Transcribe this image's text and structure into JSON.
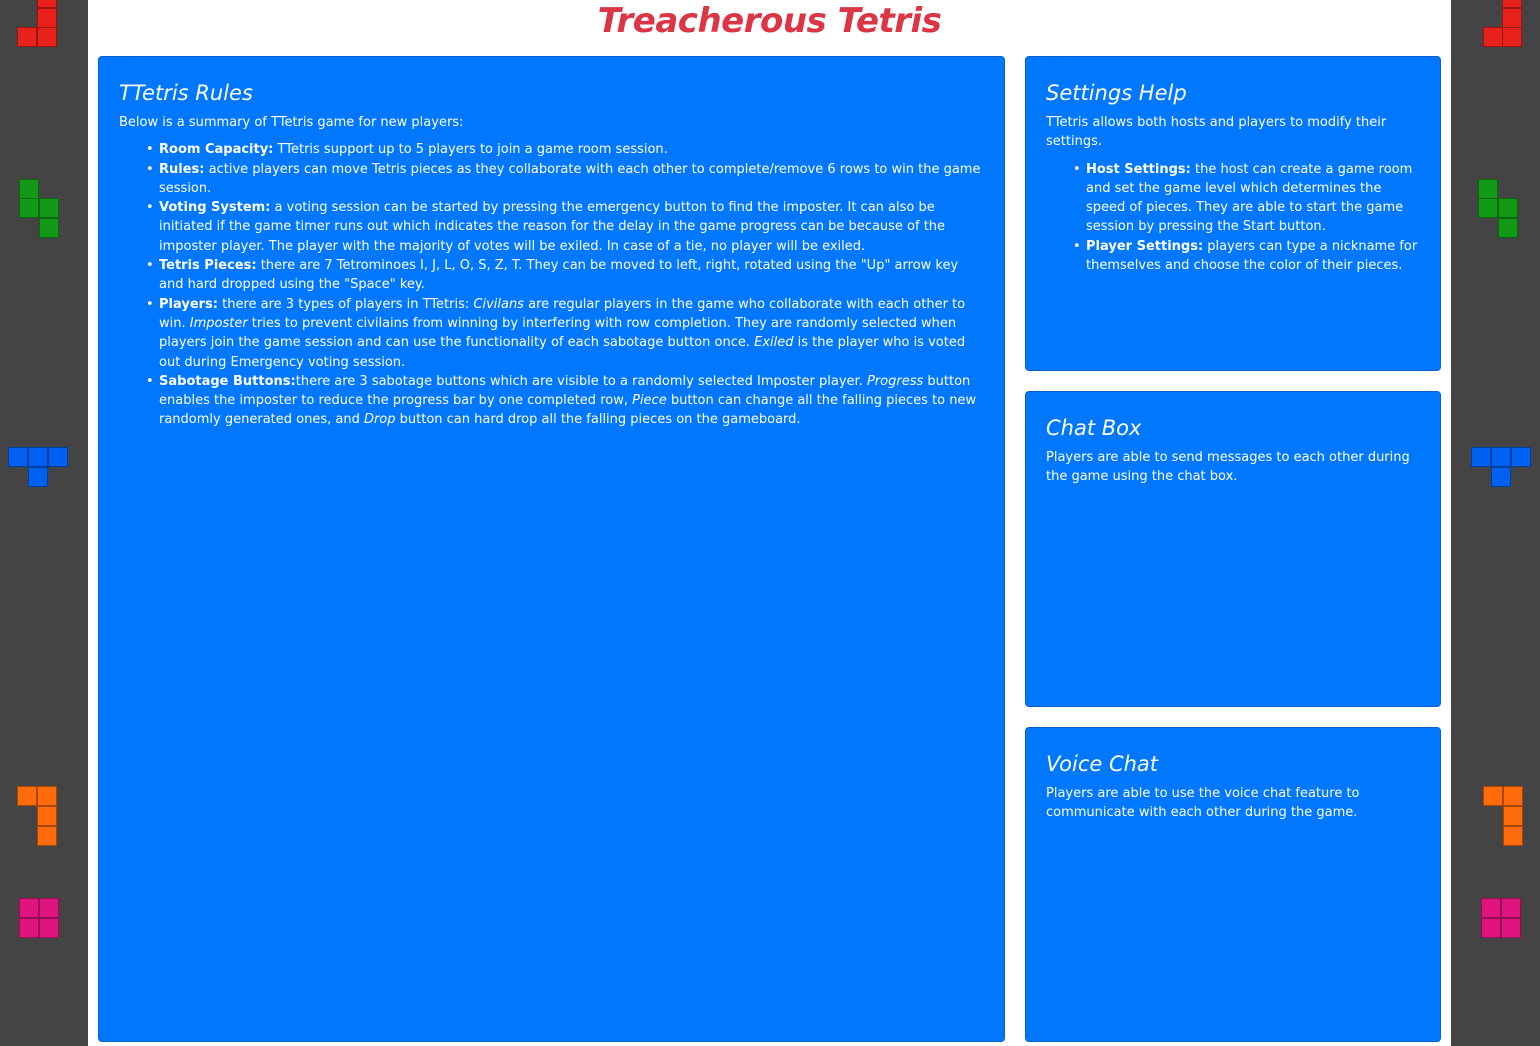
{
  "page": {
    "title": "Treacherous Tetris"
  },
  "colors": {
    "side": "#444444",
    "card": "#0077ff",
    "title": "#dc3545",
    "red": "#e8221b",
    "green": "#129a17",
    "blue": "#0060f0",
    "orange": "#ff6a0a",
    "pink": "#e0147e"
  },
  "rules": {
    "heading": "TTetris Rules",
    "intro": "Below is a summary of TTetris game for new players:",
    "items": [
      {
        "label": "Room Capacity:",
        "text": " TTetris support up to 5 players to join a game room session."
      },
      {
        "label": "Rules:",
        "text": " active players can move Tetris pieces as they collaborate with each other to complete/remove 6 rows to win the game session."
      },
      {
        "label": "Voting System:",
        "text": " a voting session can be started by pressing the emergency button to find the imposter. It can also be initiated if the game timer runs out which indicates the reason for the delay in the game progress can be because of the imposter player. The player with the majority of votes will be exiled. In case of a tie, no player will be exiled."
      },
      {
        "label": "Tetris Pieces:",
        "text": " there are 7 Tetrominoes I, J, L, O, S, Z, T. They can be moved to left, right, rotated using the \"Up\" arrow key and hard dropped using the \"Space\" key."
      },
      {
        "label": "Players:",
        "t1": " there are 3 types of players in TTetris: ",
        "civ": "Civilans",
        "t2": " are regular players in the game who collaborate with each other to win. ",
        "imp": "Imposter",
        "t3": " tries to prevent civilains from winning by interfering with row completion. They are randomly selected when players join the game session and can use the functionality of each sabotage button once. ",
        "exi": "Exiled",
        "t4": " is the player who is voted out during Emergency voting session."
      },
      {
        "label": "Sabotage Buttons:",
        "t1": "there are 3 sabotage buttons which are visible to a randomly selected Imposter player. ",
        "prog": "Progress",
        "t2": " button enables the imposter to reduce the progress bar by one completed row, ",
        "piece": "Piece",
        "t3": " button can change all the falling pieces to new randomly generated ones, and ",
        "drop": "Drop",
        "t4": " button can hard drop all the falling pieces on the gameboard."
      }
    ]
  },
  "settings": {
    "heading": "Settings Help",
    "intro": "TTetris allows both hosts and players to modify their settings.",
    "items": [
      {
        "label": "Host Settings:",
        "text": " the host can create a game room and set the game level which determines the speed of pieces. They are able to start the game session by pressing the Start button."
      },
      {
        "label": "Player Settings:",
        "text": " players can type a nickname for themselves and choose the color of their pieces."
      }
    ]
  },
  "chat": {
    "heading": "Chat Box",
    "text": "Players are able to send messages to each other during the game using the chat box."
  },
  "voice": {
    "heading": "Voice Chat",
    "text": "Players are able to use the voice chat feature to communicate with each other during the game."
  }
}
